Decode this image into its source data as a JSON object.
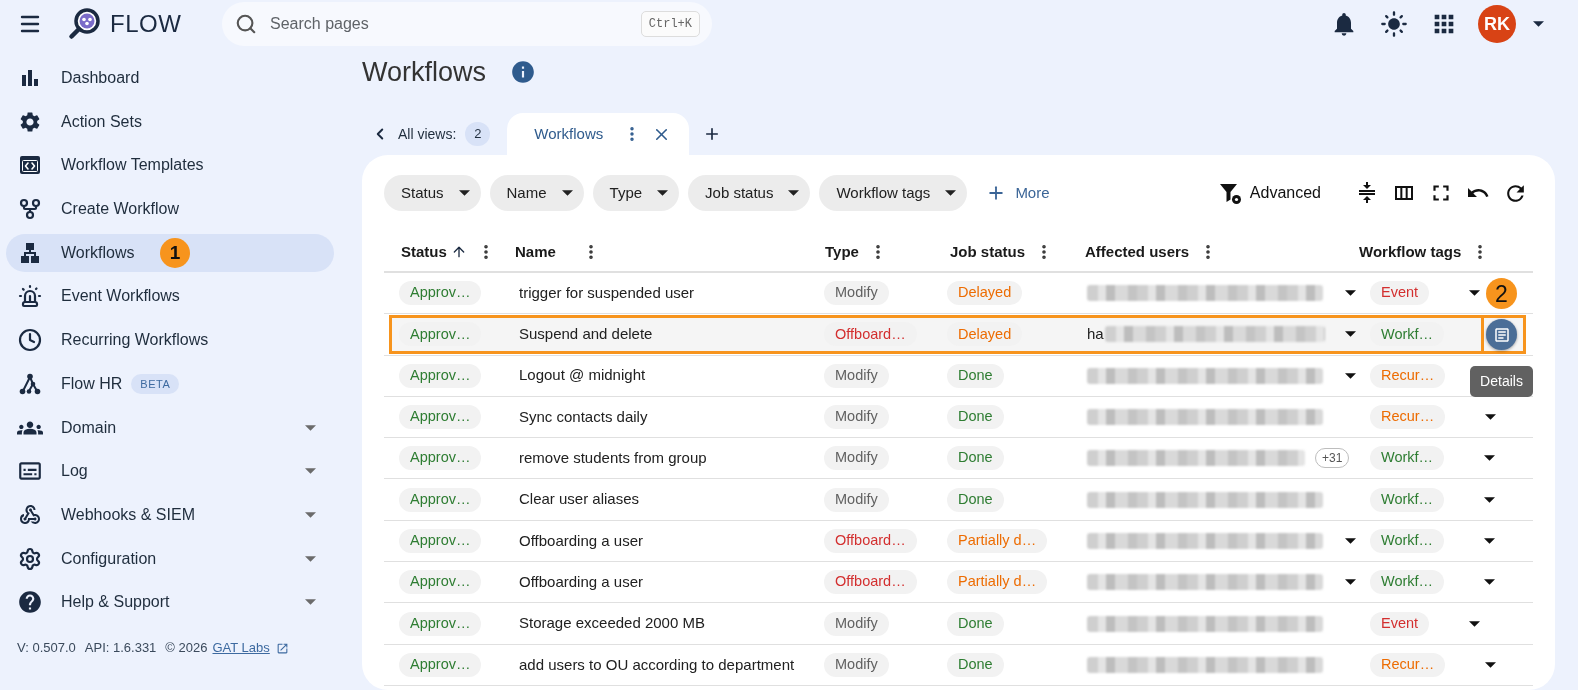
{
  "top_bar": {
    "logo_text": "FLOW",
    "search": {
      "placeholder": "Search pages",
      "shortcut": "Ctrl+K"
    },
    "avatar": "RK"
  },
  "sidebar": {
    "items": [
      {
        "label": "Dashboard",
        "selected": false,
        "expandable": false
      },
      {
        "label": "Action Sets",
        "selected": false,
        "expandable": false
      },
      {
        "label": "Workflow Templates",
        "selected": false,
        "expandable": false
      },
      {
        "label": "Create Workflow",
        "selected": false,
        "expandable": false
      },
      {
        "label": "Workflows",
        "selected": true,
        "expandable": false,
        "marker": "1"
      },
      {
        "label": "Event Workflows",
        "selected": false,
        "expandable": false
      },
      {
        "label": "Recurring Workflows",
        "selected": false,
        "expandable": false
      },
      {
        "label": "Flow HR",
        "selected": false,
        "expandable": false,
        "badge": "BETA"
      },
      {
        "label": "Domain",
        "selected": false,
        "expandable": true
      },
      {
        "label": "Log",
        "selected": false,
        "expandable": true
      },
      {
        "label": "Webhooks & SIEM",
        "selected": false,
        "expandable": true
      },
      {
        "label": "Configuration",
        "selected": false,
        "expandable": true
      },
      {
        "label": "Help & Support",
        "selected": false,
        "expandable": true
      }
    ],
    "footer": {
      "version": "V: 0.507.0",
      "api": "API: 1.6.331",
      "copyright": "© 2026",
      "link": "GAT Labs"
    }
  },
  "page": {
    "title": "Workflows"
  },
  "views": {
    "all_views_label": "All views:",
    "count": "2",
    "tabs": [
      {
        "label": "Workflows",
        "selected": true
      }
    ]
  },
  "filters": {
    "chips": [
      "Status",
      "Name",
      "Type",
      "Job status",
      "Workflow tags"
    ],
    "more": "More",
    "advanced": "Advanced"
  },
  "table": {
    "columns": [
      {
        "label": "Status",
        "sorted": true
      },
      {
        "label": "Name",
        "sorted": false
      },
      {
        "label": "Type",
        "sorted": false
      },
      {
        "label": "Job status",
        "sorted": false
      },
      {
        "label": "Affected users",
        "sorted": false
      },
      {
        "label": "Workflow tags",
        "sorted": false
      }
    ],
    "rows": [
      {
        "status": {
          "text": "Approv…",
          "color": "#2e7d32"
        },
        "name": "trigger for suspended user",
        "type": {
          "text": "Modify",
          "color": "#616161"
        },
        "job_status": {
          "text": "Delayed",
          "color": "#ed6c02"
        },
        "affected_users": {
          "caret": true
        },
        "workflow_tags": {
          "text": "Event",
          "color": "#d32f2f",
          "caret": true
        },
        "highlighted": false,
        "details_button": false
      },
      {
        "status": {
          "text": "Approv…",
          "color": "#2e7d32"
        },
        "name": "Suspend and delete",
        "type": {
          "text": "Offboard…",
          "color": "#d32f2f"
        },
        "job_status": {
          "text": "Delayed",
          "color": "#ed6c02"
        },
        "affected_users": {
          "prefix": "ha",
          "caret": true
        },
        "workflow_tags": {
          "text": "Workf…",
          "color": "#2e7d32",
          "caret": false
        },
        "highlighted": true,
        "details_button": true
      },
      {
        "status": {
          "text": "Approv…",
          "color": "#2e7d32"
        },
        "name": "Logout @ midnight",
        "type": {
          "text": "Modify",
          "color": "#616161"
        },
        "job_status": {
          "text": "Done",
          "color": "#2e7d32"
        },
        "affected_users": {
          "caret": true
        },
        "workflow_tags": {
          "text": "Recur…",
          "color": "#ed6c02",
          "caret": false
        },
        "highlighted": false,
        "details_button": false
      },
      {
        "status": {
          "text": "Approv…",
          "color": "#2e7d32"
        },
        "name": "Sync contacts daily",
        "type": {
          "text": "Modify",
          "color": "#616161"
        },
        "job_status": {
          "text": "Done",
          "color": "#2e7d32"
        },
        "affected_users": {
          "caret": false
        },
        "workflow_tags": {
          "text": "Recur…",
          "color": "#ed6c02",
          "caret": true
        },
        "highlighted": false,
        "details_button": false
      },
      {
        "status": {
          "text": "Approv…",
          "color": "#2e7d32"
        },
        "name": "remove students from group",
        "type": {
          "text": "Modify",
          "color": "#616161"
        },
        "job_status": {
          "text": "Done",
          "color": "#2e7d32"
        },
        "affected_users": {
          "more": "+31",
          "caret": false
        },
        "workflow_tags": {
          "text": "Workf…",
          "color": "#2e7d32",
          "caret": true
        },
        "highlighted": false,
        "details_button": false
      },
      {
        "status": {
          "text": "Approv…",
          "color": "#2e7d32"
        },
        "name": "Clear user aliases",
        "type": {
          "text": "Modify",
          "color": "#616161"
        },
        "job_status": {
          "text": "Done",
          "color": "#2e7d32"
        },
        "affected_users": {
          "caret": false
        },
        "workflow_tags": {
          "text": "Workf…",
          "color": "#2e7d32",
          "caret": true
        },
        "highlighted": false,
        "details_button": false
      },
      {
        "status": {
          "text": "Approv…",
          "color": "#2e7d32"
        },
        "name": "Offboarding a user",
        "type": {
          "text": "Offboard…",
          "color": "#d32f2f"
        },
        "job_status": {
          "text": "Partially d…",
          "color": "#ed6c02"
        },
        "affected_users": {
          "caret": true
        },
        "workflow_tags": {
          "text": "Workf…",
          "color": "#2e7d32",
          "caret": true
        },
        "highlighted": false,
        "details_button": false
      },
      {
        "status": {
          "text": "Approv…",
          "color": "#2e7d32"
        },
        "name": "Offboarding a user",
        "type": {
          "text": "Offboard…",
          "color": "#d32f2f"
        },
        "job_status": {
          "text": "Partially d…",
          "color": "#ed6c02"
        },
        "affected_users": {
          "caret": true
        },
        "workflow_tags": {
          "text": "Workf…",
          "color": "#2e7d32",
          "caret": true
        },
        "highlighted": false,
        "details_button": false
      },
      {
        "status": {
          "text": "Approv…",
          "color": "#2e7d32"
        },
        "name": "Storage exceeded 2000 MB",
        "type": {
          "text": "Modify",
          "color": "#616161"
        },
        "job_status": {
          "text": "Done",
          "color": "#2e7d32"
        },
        "affected_users": {
          "caret": false
        },
        "workflow_tags": {
          "text": "Event",
          "color": "#d32f2f",
          "caret": true
        },
        "highlighted": false,
        "details_button": false
      },
      {
        "status": {
          "text": "Approv…",
          "color": "#2e7d32"
        },
        "name": "add users to OU according to department",
        "type": {
          "text": "Modify",
          "color": "#616161"
        },
        "job_status": {
          "text": "Done",
          "color": "#2e7d32"
        },
        "affected_users": {
          "caret": false
        },
        "workflow_tags": {
          "text": "Recur…",
          "color": "#ed6c02",
          "caret": true
        },
        "highlighted": false,
        "details_button": false
      }
    ],
    "tooltip": "Details",
    "marker": "2"
  }
}
